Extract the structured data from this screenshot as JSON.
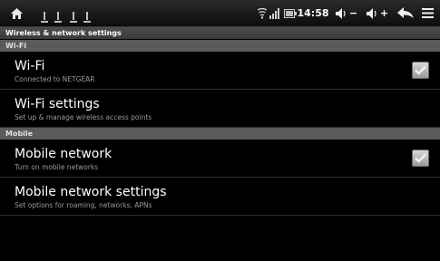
{
  "status_bar": {
    "time": "14:58",
    "vol_down_label": "−",
    "vol_up_label": "+",
    "icons": {
      "home": "home-icon",
      "notifications": "notification-icon",
      "wifi": "wifi-icon",
      "signal": "signal-icon",
      "battery": "battery-icon",
      "volume_down": "volume-down-icon",
      "volume_up": "volume-up-icon",
      "back": "back-icon",
      "menu": "menu-icon"
    }
  },
  "screen_title": "Wireless & network settings",
  "sections": {
    "wifi": {
      "header": "Wi-Fi",
      "items": [
        {
          "title": "Wi-Fi",
          "summary": "Connected to NETGEAR",
          "checked": true
        },
        {
          "title": "Wi-Fi settings",
          "summary": "Set up & manage wireless access points"
        }
      ]
    },
    "mobile": {
      "header": "Mobile",
      "items": [
        {
          "title": "Mobile network",
          "summary": "Turn on mobile networks",
          "checked": true
        },
        {
          "title": "Mobile network settings",
          "summary": "Set options for roaming, networks, APNs"
        }
      ]
    }
  },
  "colors": {
    "status_bar": "#1a1a1a",
    "title_bar": "#444444",
    "section_header": "#5b5b5b",
    "background": "#000000",
    "summary_text": "#9a9a9a"
  }
}
